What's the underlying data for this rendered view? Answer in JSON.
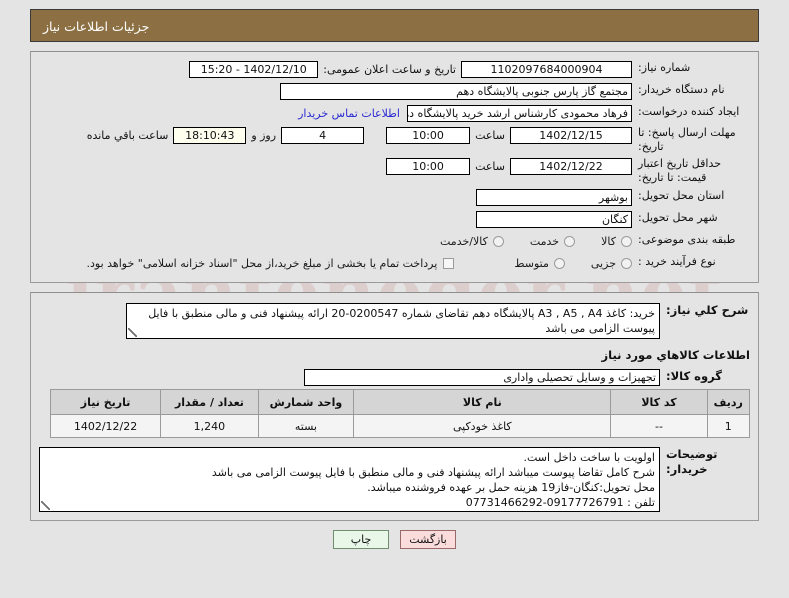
{
  "header": {
    "title": "جزئیات اطلاعات نیاز"
  },
  "watermark": {
    "text": "iranteneder.net"
  },
  "form": {
    "need_number": {
      "label": "شماره نیاز:",
      "value": "1102097684000904"
    },
    "announce": {
      "label": "تاریخ و ساعت اعلان عمومی:",
      "value": "1402/12/10 - 15:20"
    },
    "buyer_org": {
      "label": "نام دستگاه خریدار:",
      "value": "مجتمع گاز پارس جنوبی  پالایشگاه دهم"
    },
    "creator": {
      "label": "ایجاد کننده درخواست:",
      "value": "فرهاد محمودی کارشناس ارشد خرید پالایشگاه دهم  مجتمع گاز پارس جنوبی  پا",
      "link": "اطلاعات تماس خریدار"
    },
    "reply_deadline": {
      "label": "مهلت ارسال پاسخ: تا تاریخ:",
      "date": "1402/12/15",
      "time_label": "ساعت",
      "time": "10:00",
      "days": "4",
      "days_label": "روز و",
      "countdown": "18:10:43",
      "countdown_label": "ساعت باقي مانده"
    },
    "price_validity": {
      "label": "حداقل تاریخ اعتبار قیمت: تا تاریخ:",
      "date": "1402/12/22",
      "time_label": "ساعت",
      "time": "10:00"
    },
    "province": {
      "label": "استان محل تحویل:",
      "value": "بوشهر"
    },
    "city": {
      "label": "شهر محل تحویل:",
      "value": "کنگان"
    },
    "subject_class": {
      "label": "طبقه بندی موضوعی:",
      "options": [
        {
          "label": "کالا",
          "selected": false
        },
        {
          "label": "خدمت",
          "selected": false
        },
        {
          "label": "کالا/خدمت",
          "selected": false
        }
      ]
    },
    "purchase_type": {
      "label": "نوع فرآیند خرید :",
      "options": [
        {
          "label": "جزیی",
          "selected": false
        },
        {
          "label": "متوسط",
          "selected": false
        }
      ],
      "checkbox_label": "پرداخت تمام یا بخشی از مبلغ خرید،از محل \"اسناد خزانه اسلامی\" خواهد بود.",
      "checkbox_checked": false
    }
  },
  "need_summary": {
    "label": "شرح کلي نیاز:",
    "text": "خرید: کاغذ A3 , A5 , A4  پالایشگاه دهم تقاضای شماره 0200547-20 ارائه پیشنهاد فنی و مالی منطبق با فایل پیوست الزامی می باشد"
  },
  "goods_section": {
    "title": "اطلاعات كالاهاي مورد نیاز",
    "group": {
      "label": "گروه کالا:",
      "value": "تجهیزات و وسایل تحصیلی واداری"
    },
    "columns": [
      "ردیف",
      "کد کالا",
      "نام کالا",
      "واحد شمارش",
      "تعداد / مقدار",
      "تاریخ نیاز"
    ],
    "rows": [
      [
        "1",
        "--",
        "کاغذ خودکپی",
        "بسته",
        "1,240",
        "1402/12/22"
      ]
    ]
  },
  "buyer_notes": {
    "label": "توضیحات خریدار:",
    "lines": [
      "اولویت با ساخت داخل است.",
      "شرح کامل تقاضا پیوست میباشد ارائه پیشنهاد فنی و مالی منطبق با فایل پیوست الزامی می باشد",
      "محل تحویل:کنگان-فاز19 هزینه حمل بر عهده فروشنده میباشد.",
      "تلفن : 09177726791-07731466292"
    ]
  },
  "footer": {
    "print_label": "چاپ",
    "back_label": "بازگشت"
  }
}
